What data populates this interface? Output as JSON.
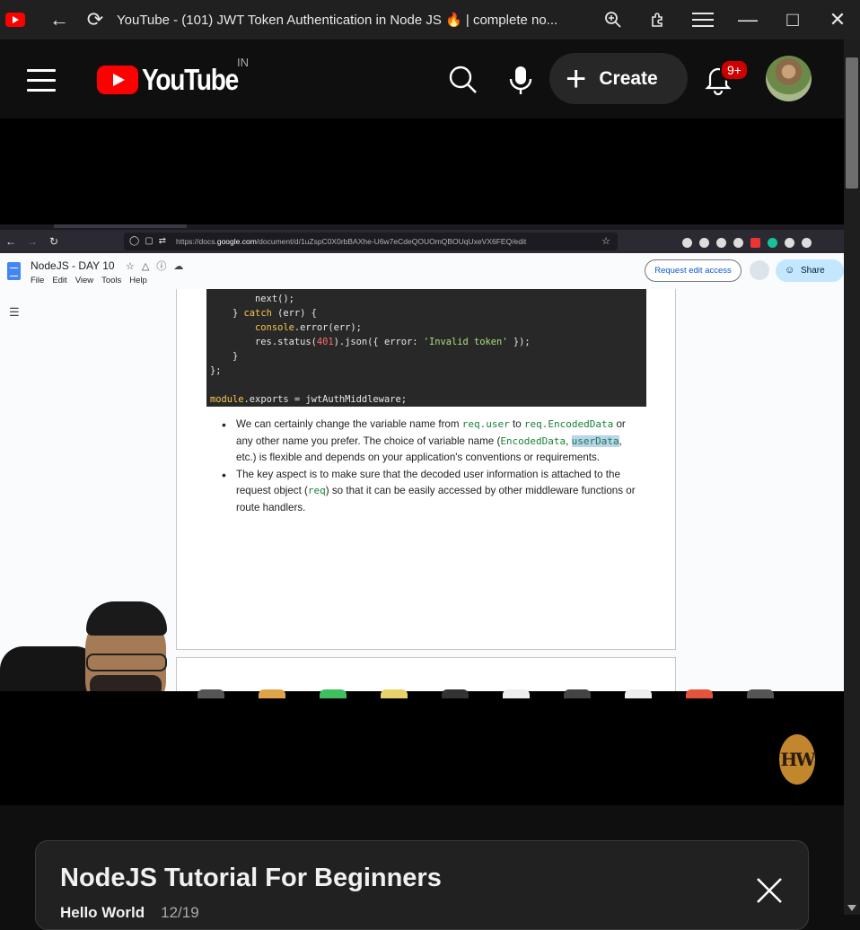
{
  "window": {
    "title": "YouTube - (101) JWT Token Authentication in Node JS 🔥 | complete no..."
  },
  "header": {
    "logo_text": "YouTube",
    "country_code": "IN",
    "create_label": "Create",
    "notification_badge": "9+"
  },
  "video": {
    "browser": {
      "url_prefix": "https://docs.",
      "url_host": "google.com",
      "url_rest": "/document/d/1uZspC0X0rbBAXhe-U6w7eCdeQOUOmQBOUqUxeVX6FEQ/edit"
    },
    "doc": {
      "title": "NodeJS - DAY 10",
      "menu": [
        "File",
        "Edit",
        "View",
        "Tools",
        "Help"
      ],
      "request_access": "Request edit access",
      "share": "Share",
      "code_lines": [
        "        next();",
        "    } catch (err) {",
        "        console.error(err);",
        "        res.status(401).json({ error: 'Invalid token' });",
        "    }",
        "};",
        "",
        "module.exports = jwtAuthMiddleware;"
      ],
      "bullet1": {
        "t1": "We can certainly change the variable name from ",
        "c1": "req.user",
        "t2": " to ",
        "c2": "req.EncodedData",
        "t3": " or any other name you prefer. The choice of variable name (",
        "c3": "EncodedData",
        "t4": ", ",
        "c4": "userData",
        "t5": ", etc.) is flexible and depends on your application's conventions or requirements."
      },
      "bullet2": {
        "t1": "The key aspect is to make sure that the decoded user information is attached to the request object (",
        "c1": "req",
        "t2": ") so that it can be easily accessed by other middleware functions or route handlers."
      }
    },
    "watermark": "HW"
  },
  "playlist": {
    "title": "NodeJS Tutorial For Beginners",
    "channel": "Hello World",
    "position": "12/19"
  }
}
